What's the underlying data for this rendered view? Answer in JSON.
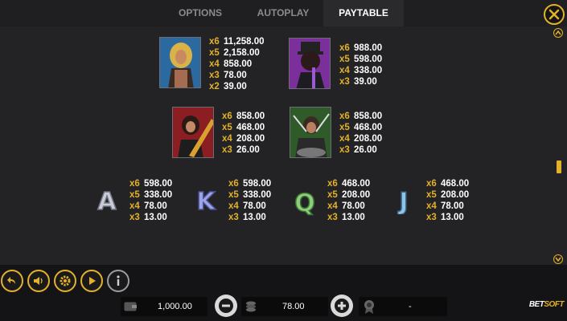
{
  "tabs": [
    {
      "label": "OPTIONS"
    },
    {
      "label": "AUTOPLAY"
    },
    {
      "label": "PAYTABLE",
      "active": true
    }
  ],
  "colors": {
    "accent": "#e3b12a",
    "multiplier": "#e3b12a",
    "value": "#ffffff",
    "background": "#232325"
  },
  "paytable": {
    "premium": [
      {
        "symbol": "guitarist-long-hair",
        "pays": [
          {
            "mult": "x6",
            "val": "11,258.00"
          },
          {
            "mult": "x5",
            "val": "2,158.00"
          },
          {
            "mult": "x4",
            "val": "858.00"
          },
          {
            "mult": "x3",
            "val": "78.00"
          },
          {
            "mult": "x2",
            "val": "39.00"
          }
        ]
      },
      {
        "symbol": "guitarist-top-hat",
        "pays": [
          {
            "mult": "x6",
            "val": "988.00"
          },
          {
            "mult": "x5",
            "val": "598.00"
          },
          {
            "mult": "x4",
            "val": "338.00"
          },
          {
            "mult": "x3",
            "val": "39.00"
          }
        ]
      },
      {
        "symbol": "guitarist-red",
        "pays": [
          {
            "mult": "x6",
            "val": "858.00"
          },
          {
            "mult": "x5",
            "val": "468.00"
          },
          {
            "mult": "x4",
            "val": "208.00"
          },
          {
            "mult": "x3",
            "val": "26.00"
          }
        ]
      },
      {
        "symbol": "drummer",
        "pays": [
          {
            "mult": "x6",
            "val": "858.00"
          },
          {
            "mult": "x5",
            "val": "468.00"
          },
          {
            "mult": "x4",
            "val": "208.00"
          },
          {
            "mult": "x3",
            "val": "26.00"
          }
        ]
      }
    ],
    "letters": [
      {
        "symbol": "A",
        "color": "#c9ccd6",
        "pays": [
          {
            "mult": "x6",
            "val": "598.00"
          },
          {
            "mult": "x5",
            "val": "338.00"
          },
          {
            "mult": "x4",
            "val": "78.00"
          },
          {
            "mult": "x3",
            "val": "13.00"
          }
        ]
      },
      {
        "symbol": "K",
        "color": "#9aa4e6",
        "pays": [
          {
            "mult": "x6",
            "val": "598.00"
          },
          {
            "mult": "x5",
            "val": "338.00"
          },
          {
            "mult": "x4",
            "val": "78.00"
          },
          {
            "mult": "x3",
            "val": "13.00"
          }
        ]
      },
      {
        "symbol": "Q",
        "color": "#8ad07a",
        "pays": [
          {
            "mult": "x6",
            "val": "468.00"
          },
          {
            "mult": "x5",
            "val": "208.00"
          },
          {
            "mult": "x4",
            "val": "78.00"
          },
          {
            "mult": "x3",
            "val": "13.00"
          }
        ]
      },
      {
        "symbol": "J",
        "color": "#8ec4e8",
        "pays": [
          {
            "mult": "x6",
            "val": "468.00"
          },
          {
            "mult": "x5",
            "val": "208.00"
          },
          {
            "mult": "x4",
            "val": "78.00"
          },
          {
            "mult": "x3",
            "val": "13.00"
          }
        ]
      }
    ]
  },
  "bottom": {
    "balance": "1,000.00",
    "bet": "78.00",
    "win": "-",
    "brand": {
      "part1": "BET",
      "part2": "SOFT"
    }
  },
  "icons": [
    "close-icon",
    "scroll-up-icon",
    "scroll-down-icon",
    "back-icon",
    "sound-icon",
    "settings-icon",
    "autoplay-icon",
    "info-icon",
    "wallet-icon",
    "minus-icon",
    "coins-icon",
    "plus-icon",
    "medal-icon"
  ]
}
